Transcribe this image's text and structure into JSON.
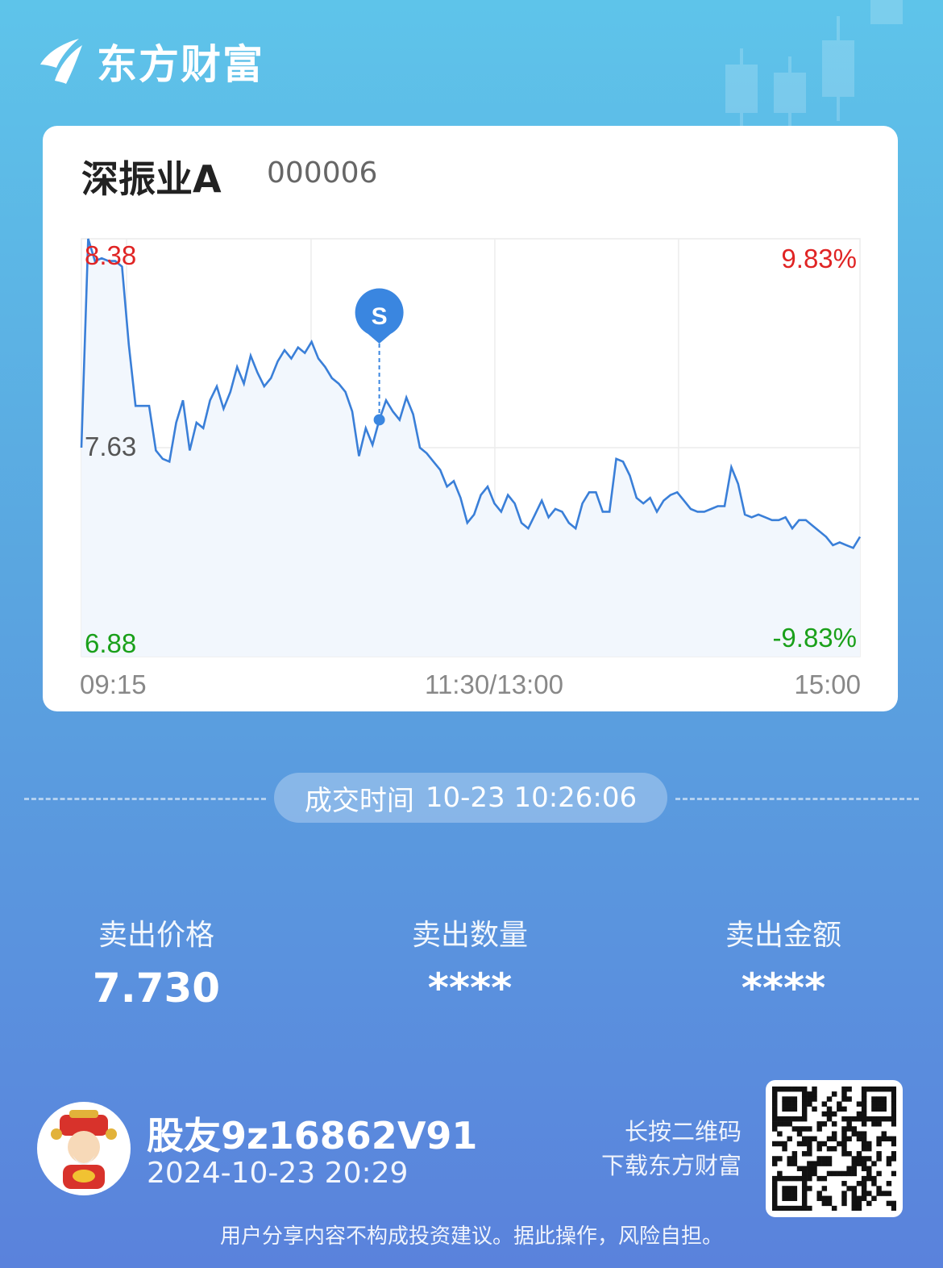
{
  "brand": {
    "name": "东方财富",
    "logo_icon": "eastmoney-logo-icon"
  },
  "stock": {
    "name": "深振业A",
    "code": "000006"
  },
  "chart_data": {
    "type": "line",
    "title": "",
    "prev_close": 7.63,
    "y_labels": {
      "high": "8.38",
      "mid": "7.63",
      "low": "6.88"
    },
    "pct_labels": {
      "high": "9.83%",
      "low": "-9.83%"
    },
    "ylim": [
      6.88,
      8.38
    ],
    "x_labels": [
      "09:15",
      "11:30/13:00",
      "15:00"
    ],
    "grid": true,
    "series": [
      {
        "values": [
          7.63,
          8.38,
          8.3,
          8.31,
          8.3,
          8.3,
          8.28,
          8.0,
          7.78,
          7.78,
          7.78,
          7.62,
          7.59,
          7.58,
          7.72,
          7.8,
          7.62,
          7.72,
          7.7,
          7.8,
          7.85,
          7.77,
          7.83,
          7.92,
          7.86,
          7.96,
          7.9,
          7.85,
          7.88,
          7.94,
          7.98,
          7.95,
          7.99,
          7.97,
          8.01,
          7.95,
          7.92,
          7.88,
          7.86,
          7.83,
          7.76,
          7.6,
          7.7,
          7.64,
          7.73,
          7.8,
          7.76,
          7.73,
          7.81,
          7.75,
          7.63,
          7.61,
          7.58,
          7.55,
          7.49,
          7.51,
          7.45,
          7.36,
          7.39,
          7.46,
          7.49,
          7.43,
          7.4,
          7.46,
          7.43,
          7.36,
          7.34,
          7.39,
          7.44,
          7.38,
          7.41,
          7.4,
          7.36,
          7.34,
          7.43,
          7.47,
          7.47,
          7.4,
          7.4,
          7.59,
          7.58,
          7.53,
          7.45,
          7.43,
          7.45,
          7.4,
          7.44,
          7.46,
          7.47,
          7.44,
          7.41,
          7.4,
          7.4,
          7.41,
          7.42,
          7.42,
          7.56,
          7.5,
          7.39,
          7.38,
          7.39,
          7.38,
          7.37,
          7.37,
          7.38,
          7.34,
          7.37,
          7.37,
          7.35,
          7.33,
          7.31,
          7.28,
          7.29,
          7.28,
          7.27,
          7.31
        ],
        "sell_marker": {
          "time": "10:26",
          "price": 7.73,
          "label": "S"
        }
      }
    ]
  },
  "trade": {
    "label": "成交时间",
    "time": "10-23 10:26:06"
  },
  "stats": [
    {
      "label": "卖出价格",
      "value": "7.730"
    },
    {
      "label": "卖出数量",
      "value": "****"
    },
    {
      "label": "卖出金额",
      "value": "****"
    }
  ],
  "user": {
    "name": "股友9z16862V91",
    "time": "2024-10-23 20:29",
    "avatar_icon": "avatar-icon"
  },
  "qr": {
    "hint_line1": "长按二维码",
    "hint_line2": "下载东方财富",
    "icon": "qr-code-icon"
  },
  "disclaimer": "用户分享内容不构成投资建议。据此操作，风险自担。",
  "colors": {
    "up": "#e02424",
    "down": "#1aa01a",
    "line": "#3a7fd8",
    "accent": "#3a86e0"
  }
}
